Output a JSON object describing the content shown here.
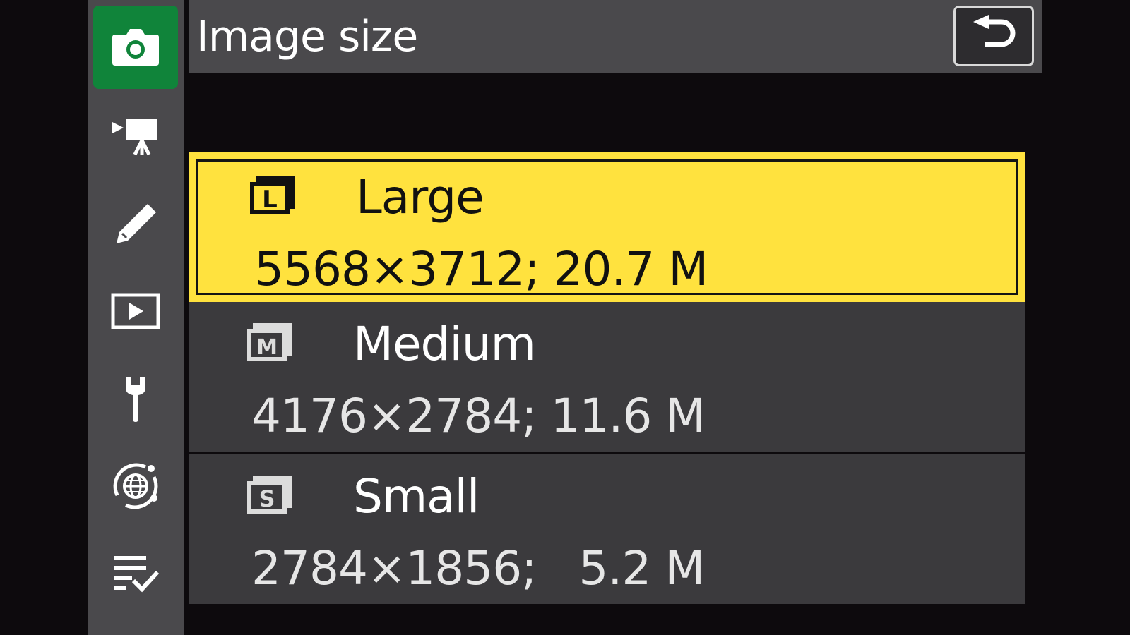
{
  "header": {
    "title": "Image size",
    "back_icon": "return-arrow-icon"
  },
  "sidebar": {
    "items": [
      {
        "name": "photo-shooting-menu",
        "icon": "camera-icon",
        "active": true
      },
      {
        "name": "movie-recording-menu",
        "icon": "movie-camera-icon",
        "active": false
      },
      {
        "name": "custom-settings-menu",
        "icon": "pencil-icon",
        "active": false
      },
      {
        "name": "playback-menu",
        "icon": "play-icon",
        "active": false
      },
      {
        "name": "setup-menu",
        "icon": "wrench-icon",
        "active": false
      },
      {
        "name": "network-menu",
        "icon": "globe-network-icon",
        "active": false
      },
      {
        "name": "my-menu",
        "icon": "checklist-icon",
        "active": false
      }
    ]
  },
  "options": [
    {
      "size_code": "L",
      "label": "Large",
      "value": "5568×3712; 20.7 M",
      "selected": true
    },
    {
      "size_code": "M",
      "label": "Medium",
      "value": "4176×2784; 11.6 M",
      "selected": false
    },
    {
      "size_code": "S",
      "label": "Small",
      "value": "2784×1856;   5.2 M",
      "selected": false
    }
  ],
  "colors": {
    "active_tab": "#10843a",
    "selection": "#ffe23e",
    "panel": "#4a494c",
    "option_bg": "#3b3a3d",
    "background": "#0d0a0d"
  }
}
